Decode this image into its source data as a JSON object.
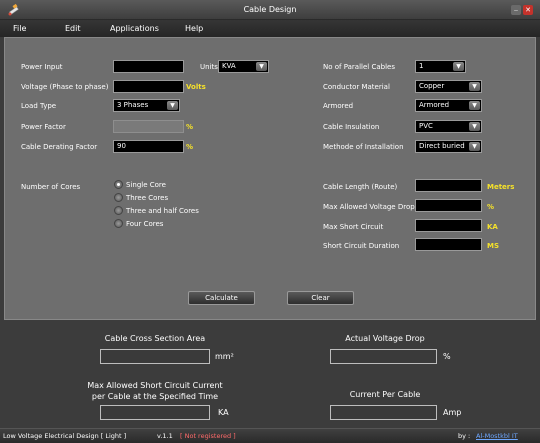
{
  "window": {
    "title": "Cable Design",
    "icon": "cable-pen-icon",
    "minimize_glyph": "‒",
    "close_glyph": "✕"
  },
  "menu": [
    "File",
    "Edit",
    "Applications",
    "Help"
  ],
  "left_form": {
    "power_input": {
      "label": "Power Input",
      "value": ""
    },
    "units": {
      "label": "Units",
      "value": "KVA"
    },
    "voltage": {
      "label": "Voltage (Phase to phase)",
      "value": "",
      "unit": "Volts"
    },
    "load_type": {
      "label": "Load Type",
      "value": "3 Phases"
    },
    "power_factor": {
      "label": "Power Factor",
      "value": "",
      "unit": "%"
    },
    "derating": {
      "label": "Cable Derating Factor",
      "value": "90",
      "unit": "%"
    }
  },
  "right_form": {
    "parallel": {
      "label": "No of Parallel Cables",
      "value": "1"
    },
    "conductor": {
      "label": "Conductor Material",
      "value": "Copper"
    },
    "armored": {
      "label": "Armored",
      "value": "Armored"
    },
    "insulation": {
      "label": "Cable Insulation",
      "value": "PVC"
    },
    "installation": {
      "label": "Methode of Installation",
      "value": "Direct buried"
    }
  },
  "cores": {
    "label": "Number of Cores",
    "options": [
      "Single Core",
      "Three Cores",
      "Three and half Cores",
      "Four Cores"
    ],
    "selected": 0
  },
  "right_inputs": {
    "length": {
      "label": "Cable Length (Route)",
      "value": "",
      "unit": "Meters"
    },
    "vdrop": {
      "label": "Max Allowed Voltage Drop",
      "value": "",
      "unit": "%"
    },
    "short": {
      "label": "Max Short Circuit",
      "value": "",
      "unit": "KA"
    },
    "duration": {
      "label": "Short Circuit Duration",
      "value": "",
      "unit": "MS"
    }
  },
  "buttons": {
    "calculate": "Calculate",
    "clear": "Clear"
  },
  "results": {
    "cross_section": {
      "label": "Cable Cross Section Area",
      "unit": "mm²"
    },
    "actual_vdrop": {
      "label": "Actual Voltage Drop",
      "unit": "%"
    },
    "short_current": {
      "label_line1": "Max Allowed Short Circuit Current",
      "label_line2": "per Cable at the Specified Time",
      "unit": "KA"
    },
    "current_per_cable": {
      "label": "Current Per Cable",
      "unit": "Amp"
    }
  },
  "status": {
    "product": "Low Voltage Electrical Design [ Light ]",
    "version": "v.1.1",
    "registration": "[ Not registered ]",
    "by_label": "by :",
    "author": "Al-Mostkbl IT"
  }
}
